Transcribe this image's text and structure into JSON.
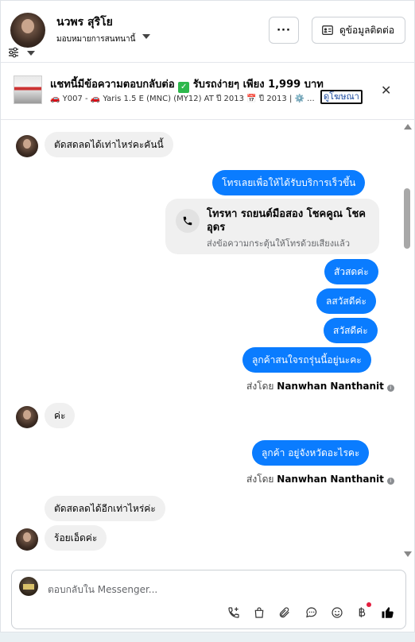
{
  "header": {
    "name": "นวพร สุริโย",
    "assign_label": "มอบหมายการสนทนานี้",
    "more_label": "···",
    "contact_label": "ดูข้อมูลติดต่อ"
  },
  "ad": {
    "title": "แชทนี้มีข้อความตอบกลับต่อ",
    "title_tail": "รับรถง่ายๆ เพียง 1,999 บาท",
    "subtitle": "🚗 Y007 - 🚗 Yaris 1.5 E (MNC) (MY12) AT ปี 2013 📅 ปี 2013 | ⚙️ ...",
    "link_label": "ดูโฆษณา",
    "close_label": "✕"
  },
  "messages": {
    "m1": "ตัดสดลดได้เท่าไหร่คะคันนี้",
    "m2": "โทรเลยเพื่อให้ได้รับบริการเร็วขึ้น",
    "call_title": "โทรหา รถยนต์มือสอง โชคคูณ โชค อุดร",
    "call_sub": "ส่งข้อความกระตุ้นให้โทรด้วยเสียงแล้ว",
    "m3": "สัวสดค่ะ",
    "m4": "ลสวัสดีค่ะ",
    "m5": "สวัสดีค่ะ",
    "m6": "ลูกค้าสนใจรถรุ่นนี้อยู่นะคะ",
    "sent_prefix": "ส่งโดย",
    "sent_name": "Nanwhan Nanthanit",
    "m7": "ค่ะ",
    "m8": "ลูกค้า อยู่จังหวัดอะไรคะ",
    "m9": "ตัดสดลดได้อีกเท่าไหร่ค่ะ",
    "m10": "ร้อยเอ็ดค่ะ"
  },
  "composer": {
    "placeholder": "ตอบกลับใน Messenger..."
  }
}
